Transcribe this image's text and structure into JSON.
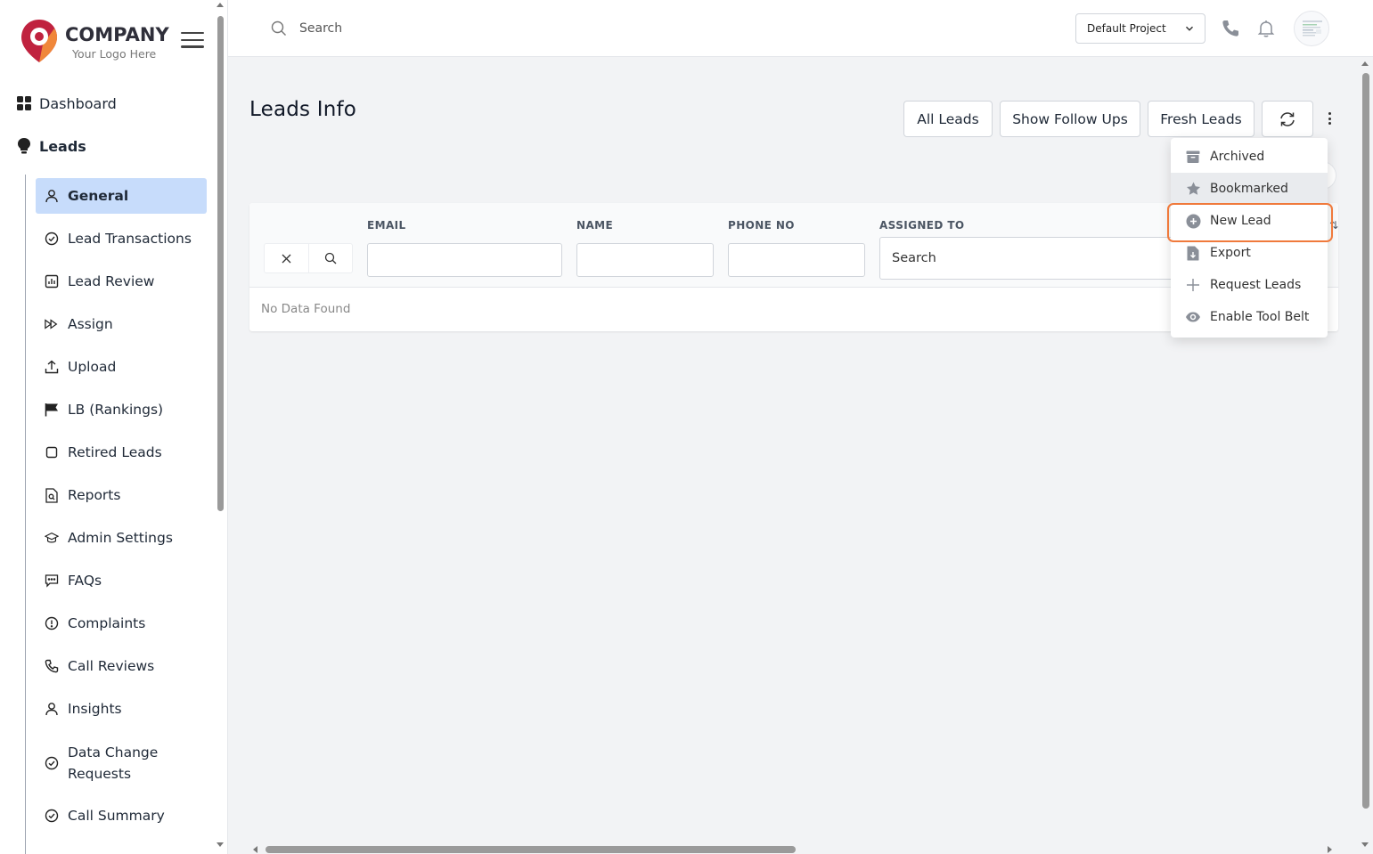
{
  "brand": {
    "name": "COMPANY",
    "tagline": "Your Logo Here",
    "colors": {
      "primary": "#c0223f",
      "secondary": "#f0873a"
    }
  },
  "sidebar": {
    "top_items": [
      {
        "label": "Dashboard",
        "icon": "grid-icon"
      },
      {
        "label": "Leads",
        "icon": "lightbulb-icon"
      }
    ],
    "sub_items": [
      {
        "label": "General",
        "icon": "user-icon",
        "active": true
      },
      {
        "label": "Lead Transactions",
        "icon": "check-circle-icon"
      },
      {
        "label": "Lead Review",
        "icon": "chart-icon"
      },
      {
        "label": "Assign",
        "icon": "fast-forward-icon"
      },
      {
        "label": "Upload",
        "icon": "upload-icon"
      },
      {
        "label": "LB (Rankings)",
        "icon": "flag-icon"
      },
      {
        "label": "Retired Leads",
        "icon": "square-icon"
      },
      {
        "label": "Reports",
        "icon": "file-search-icon"
      },
      {
        "label": "Admin Settings",
        "icon": "graduation-cap-icon"
      },
      {
        "label": "FAQs",
        "icon": "chat-icon"
      },
      {
        "label": "Complaints",
        "icon": "alert-circle-icon"
      },
      {
        "label": "Call Reviews",
        "icon": "phone-icon"
      },
      {
        "label": "Insights",
        "icon": "user-icon"
      },
      {
        "label": "Data Change Requests",
        "icon": "check-circle-icon"
      },
      {
        "label": "Call Summary",
        "icon": "check-circle-icon"
      }
    ]
  },
  "header": {
    "search_placeholder": "Search",
    "project_selected": "Default Project",
    "icons": [
      "phone-icon",
      "bell-icon",
      "avatar"
    ]
  },
  "main": {
    "title": "Leads Info",
    "buttons": {
      "all_leads": "All Leads",
      "follow_ups": "Show Follow Ups",
      "fresh_leads": "Fresh Leads"
    },
    "table": {
      "columns": [
        "EMAIL",
        "NAME",
        "PHONE NO",
        "ASSIGNED TO"
      ],
      "assigned_placeholder": "Search",
      "empty_text": "No Data Found"
    }
  },
  "dropdown": {
    "items": [
      {
        "label": "Archived",
        "icon": "archive-icon"
      },
      {
        "label": "Bookmarked",
        "icon": "star-icon"
      },
      {
        "label": "New Lead",
        "icon": "plus-circle-icon"
      },
      {
        "label": "Export",
        "icon": "file-download-icon"
      },
      {
        "label": "Request Leads",
        "icon": "plus-icon"
      },
      {
        "label": "Enable Tool Belt",
        "icon": "eye-icon"
      }
    ],
    "hovered": "Bookmarked",
    "highlighted": "New Lead",
    "highlight_color": "#f07a3c"
  }
}
